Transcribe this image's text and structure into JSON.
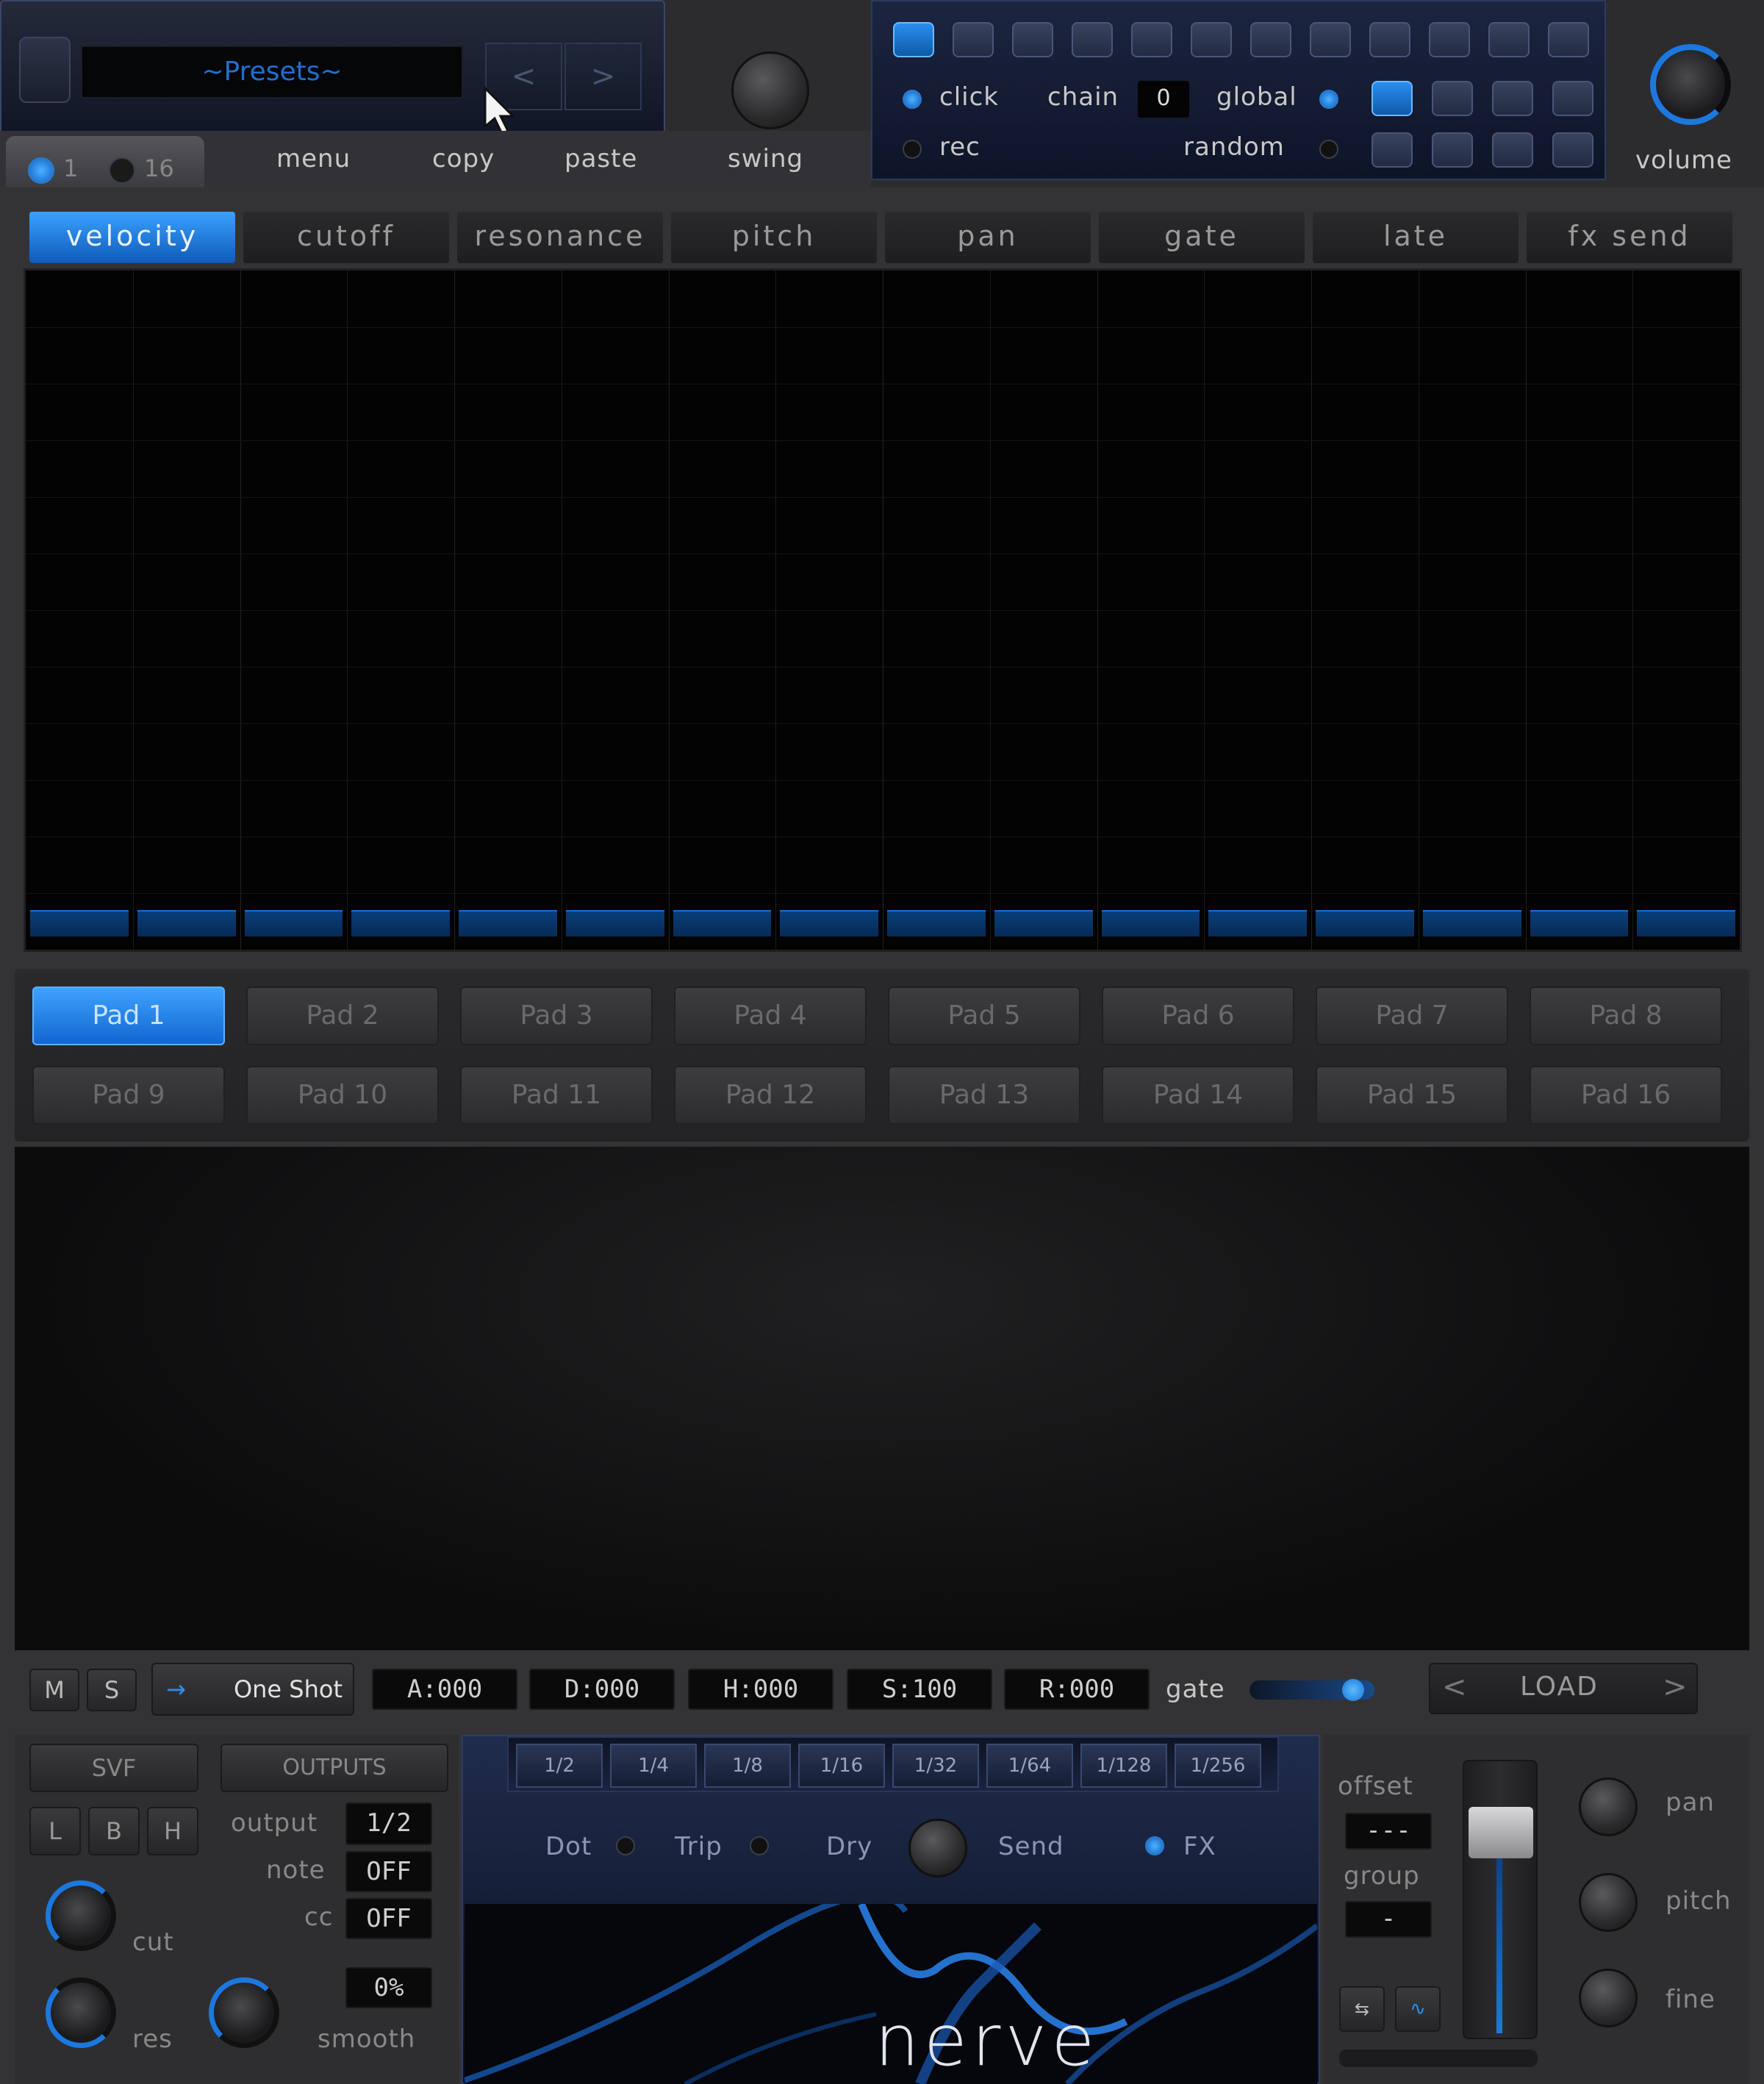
{
  "presets": {
    "label": "~Presets~",
    "prev": "<",
    "next": ">"
  },
  "top": {
    "menu": "menu",
    "copy": "copy",
    "paste": "paste",
    "swing": "swing",
    "volume": "volume"
  },
  "pattern_tabs": [
    "1",
    "16"
  ],
  "sequencer": {
    "click": "click",
    "chain": "chain",
    "chain_value": "0",
    "global": "global",
    "rec": "rec",
    "random": "random"
  },
  "param_tabs": [
    "velocity",
    "cutoff",
    "resonance",
    "pitch",
    "pan",
    "gate",
    "late",
    "fx send"
  ],
  "active_param": "velocity",
  "pads": [
    "Pad 1",
    "Pad 2",
    "Pad 3",
    "Pad 4",
    "Pad 5",
    "Pad 6",
    "Pad 7",
    "Pad 8",
    "Pad 9",
    "Pad 10",
    "Pad 11",
    "Pad 12",
    "Pad 13",
    "Pad 14",
    "Pad 15",
    "Pad 16"
  ],
  "active_pad": "Pad 1",
  "sample_bar": {
    "m": "M",
    "s": "S",
    "mode": "One Shot",
    "a": "A:000",
    "d": "D:000",
    "h": "H:000",
    "s_val": "S:100",
    "r": "R:000",
    "gate": "gate",
    "load": "LOAD",
    "prev": "<",
    "next": ">",
    "gate_level": 0.9
  },
  "svf": {
    "title": "SVF",
    "l": "L",
    "b": "B",
    "h": "H",
    "cut": "cut",
    "res": "res"
  },
  "outputs": {
    "title": "OUTPUTS",
    "output_label": "output",
    "output_value": "1/2",
    "note_label": "note",
    "note_value": "OFF",
    "cc_label": "cc",
    "cc_value": "OFF",
    "smooth_value": "0%",
    "smooth_label": "smooth"
  },
  "divisions": [
    "1/2",
    "1/4",
    "1/8",
    "1/16",
    "1/32",
    "1/64",
    "1/128",
    "1/256"
  ],
  "fx": {
    "dot": "Dot",
    "trip": "Trip",
    "dry": "Dry",
    "send": "Send",
    "fx": "FX"
  },
  "brand": "nerve",
  "right": {
    "offset": "offset",
    "offset_value": "---",
    "group": "group",
    "group_value": "-",
    "pan": "pan",
    "pitch": "pitch",
    "fine": "fine"
  },
  "colors": {
    "accent": "#1f7fe8",
    "bg": "#2c2c2e",
    "grid": "#030303"
  }
}
